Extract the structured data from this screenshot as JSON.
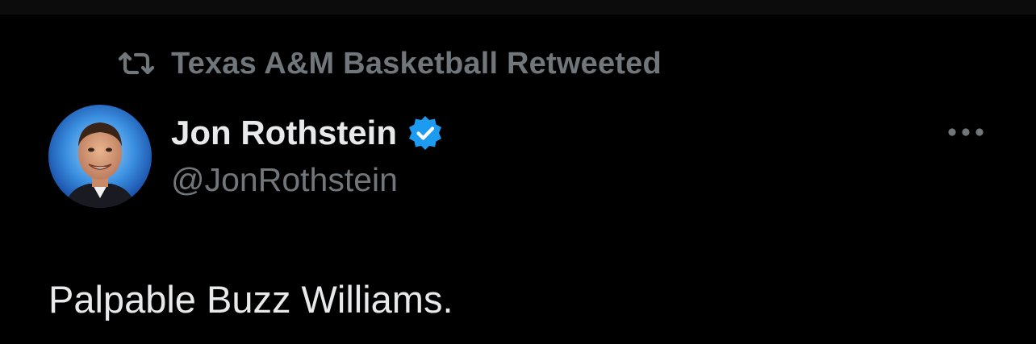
{
  "retweet": {
    "icon": "retweet-icon",
    "text": "Texas A&M Basketball Retweeted"
  },
  "author": {
    "display_name": "Jon Rothstein",
    "handle": "@JonRothstein",
    "verified": true,
    "verified_icon": "verified-badge-icon",
    "avatar": "profile-photo"
  },
  "menu": {
    "icon": "more-options-icon"
  },
  "tweet": {
    "text": "Palpable Buzz Williams."
  },
  "colors": {
    "background": "#000000",
    "primary_text": "#e7e9ea",
    "secondary_text": "#71767b",
    "verified_blue": "#1d9bf0"
  }
}
